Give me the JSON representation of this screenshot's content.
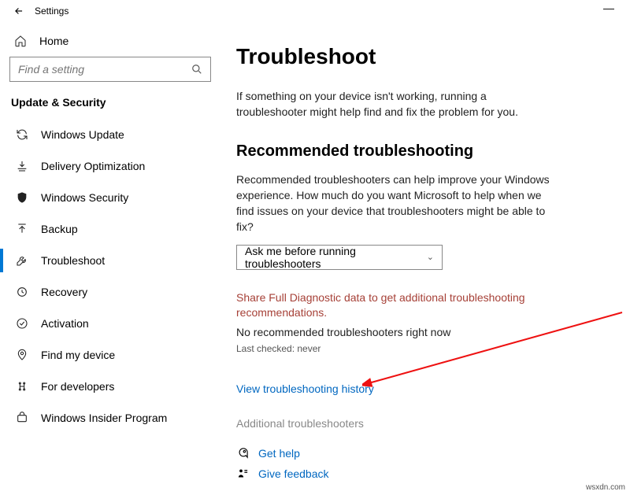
{
  "titlebar": {
    "title": "Settings"
  },
  "sidebar": {
    "home_label": "Home",
    "search_placeholder": "Find a setting",
    "section_label": "Update & Security",
    "items": [
      {
        "label": "Windows Update"
      },
      {
        "label": "Delivery Optimization"
      },
      {
        "label": "Windows Security"
      },
      {
        "label": "Backup"
      },
      {
        "label": "Troubleshoot"
      },
      {
        "label": "Recovery"
      },
      {
        "label": "Activation"
      },
      {
        "label": "Find my device"
      },
      {
        "label": "For developers"
      },
      {
        "label": "Windows Insider Program"
      }
    ]
  },
  "main": {
    "heading": "Troubleshoot",
    "intro": "If something on your device isn't working, running a troubleshooter might help find and fix the problem for you.",
    "rec_heading": "Recommended troubleshooting",
    "rec_body": "Recommended troubleshooters can help improve your Windows experience. How much do you want Microsoft to help when we find issues on your device that troubleshooters might be able to fix?",
    "dropdown_value": "Ask me before running troubleshooters",
    "warn_text": "Share Full Diagnostic data to get additional troubleshooting recommendations.",
    "none_text": "No recommended troubleshooters right now",
    "last_checked": "Last checked: never",
    "history_link": "View troubleshooting history",
    "additional": "Additional troubleshooters",
    "get_help": "Get help",
    "give_feedback": "Give feedback"
  },
  "watermark": "wsxdn.com"
}
